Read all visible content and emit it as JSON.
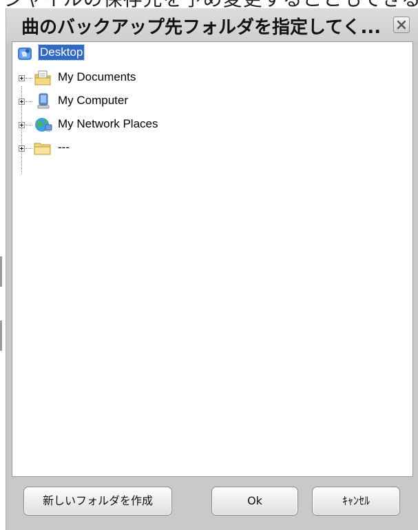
{
  "background": {
    "clipped_text": "ジャイルの保存先を予め変更することもできる"
  },
  "dialog": {
    "title": "曲のバックアップ先フォルダを指定してく...",
    "close_icon": "close-x"
  },
  "tree": {
    "items": [
      {
        "label": "Desktop",
        "icon": "desktop-folder-icon",
        "selected": true
      },
      {
        "label": "My Documents",
        "icon": "documents-folder-icon"
      },
      {
        "label": "My Computer",
        "icon": "computer-icon"
      },
      {
        "label": "My Network Places",
        "icon": "network-places-icon"
      },
      {
        "label": "---",
        "icon": "folder-icon"
      }
    ]
  },
  "buttons": {
    "new_folder": "新しいフォルダを作成",
    "ok": "Ok",
    "cancel": "ｷｬﾝｾﾙ"
  },
  "colors": {
    "selection": "#316ac5",
    "dialog_bg": "#c9c9c9"
  }
}
